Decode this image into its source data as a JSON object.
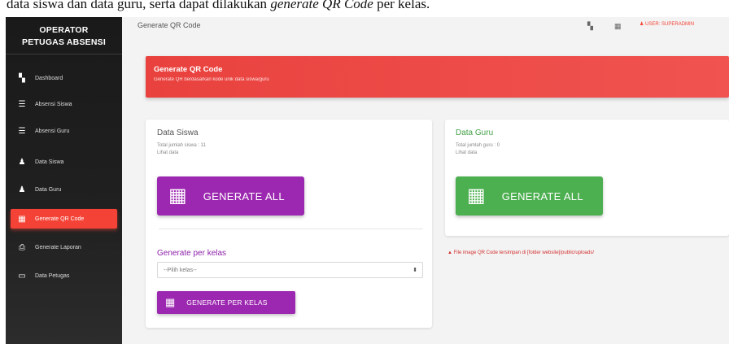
{
  "caption": {
    "prefix": "data siswa dan data guru, serta dapat dilakukan ",
    "emphasis": "generate QR Code",
    "suffix": " per kelas."
  },
  "sidebar": {
    "brand_line1": "OPERATOR",
    "brand_line2": "PETUGAS ABSENSI",
    "items": [
      {
        "label": "Dashboard",
        "icon": "dashboard-icon",
        "glyph": "▚"
      },
      {
        "label": "Absensi Siswa",
        "icon": "checklist-icon",
        "glyph": "☰"
      },
      {
        "label": "Absensi Guru",
        "icon": "checklist-icon",
        "glyph": "☰"
      },
      {
        "label": "Data Siswa",
        "icon": "person-icon",
        "glyph": "♟"
      },
      {
        "label": "Data Guru",
        "icon": "person-icon",
        "glyph": "♟"
      },
      {
        "label": "Generate QR Code",
        "icon": "qr-code-icon",
        "glyph": "▦",
        "active": true
      },
      {
        "label": "Generate Laporan",
        "icon": "printer-icon",
        "glyph": "⎙"
      },
      {
        "label": "Data Petugas",
        "icon": "monitor-icon",
        "glyph": "▭"
      }
    ]
  },
  "topbar": {
    "title": "Generate QR Code",
    "user_label": "USER: SUPERADMIN"
  },
  "banner": {
    "title": "Generate QR Code",
    "subtitle": "Generate QR berdasarkan kode unik data siswa/guru"
  },
  "siswa": {
    "title": "Data Siswa",
    "total": "Total jumlah siswa : 11",
    "link": "Lihat data",
    "button": "GENERATE ALL"
  },
  "guru": {
    "title": "Data Guru",
    "total": "Total jumlah guru : 0",
    "link": "Lihat data",
    "button": "GENERATE ALL"
  },
  "per_kelas": {
    "title": "Generate per kelas",
    "select_value": "--Pilih kelas--",
    "button": "GENERATE PER KELAS"
  },
  "note": "File image QR Code tersimpan di [folder website]/public/uploads/",
  "colors": {
    "accent_red": "#f44336",
    "purple": "#9c27b0",
    "green": "#4caf50",
    "sidebar_bg": "#1a1a1a"
  }
}
